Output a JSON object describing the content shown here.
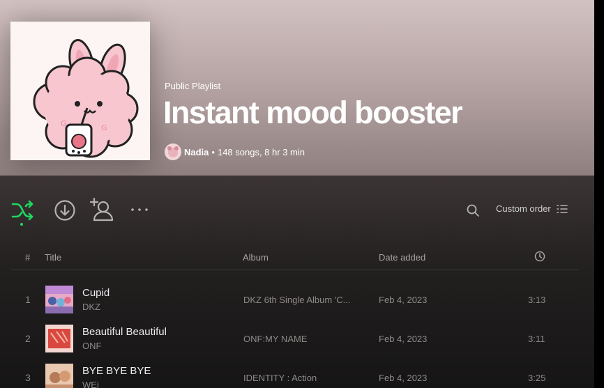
{
  "playlist": {
    "type_label": "Public Playlist",
    "title": "Instant mood booster",
    "owner": "Nadia",
    "separator": "•",
    "stats": "148 songs, 8 hr 3 min",
    "cover_icon": "pink-bunny-boba-illustration"
  },
  "actions": {
    "shuffle_icon": "shuffle-icon",
    "download_icon": "download-icon",
    "add_user_icon": "add-user-icon",
    "more_icon": "more-options-icon",
    "search_icon": "search-icon",
    "sort_label": "Custom order",
    "sort_icon": "list-icon",
    "accent_color": "#1ed760"
  },
  "table": {
    "headers": {
      "num": "#",
      "title": "Title",
      "album": "Album",
      "date": "Date added",
      "duration_icon": "clock-icon"
    },
    "rows": [
      {
        "num": "1",
        "title": "Cupid",
        "artist": "DKZ",
        "album": "DKZ 6th Single Album 'C...",
        "date": "Feb 4, 2023",
        "duration": "3:13"
      },
      {
        "num": "2",
        "title": "Beautiful Beautiful",
        "artist": "ONF",
        "album": "ONF:MY NAME",
        "date": "Feb 4, 2023",
        "duration": "3:11"
      },
      {
        "num": "3",
        "title": "BYE BYE BYE",
        "artist": "WEi",
        "album": "IDENTITY : Action",
        "date": "Feb 4, 2023",
        "duration": "3:25"
      }
    ]
  }
}
